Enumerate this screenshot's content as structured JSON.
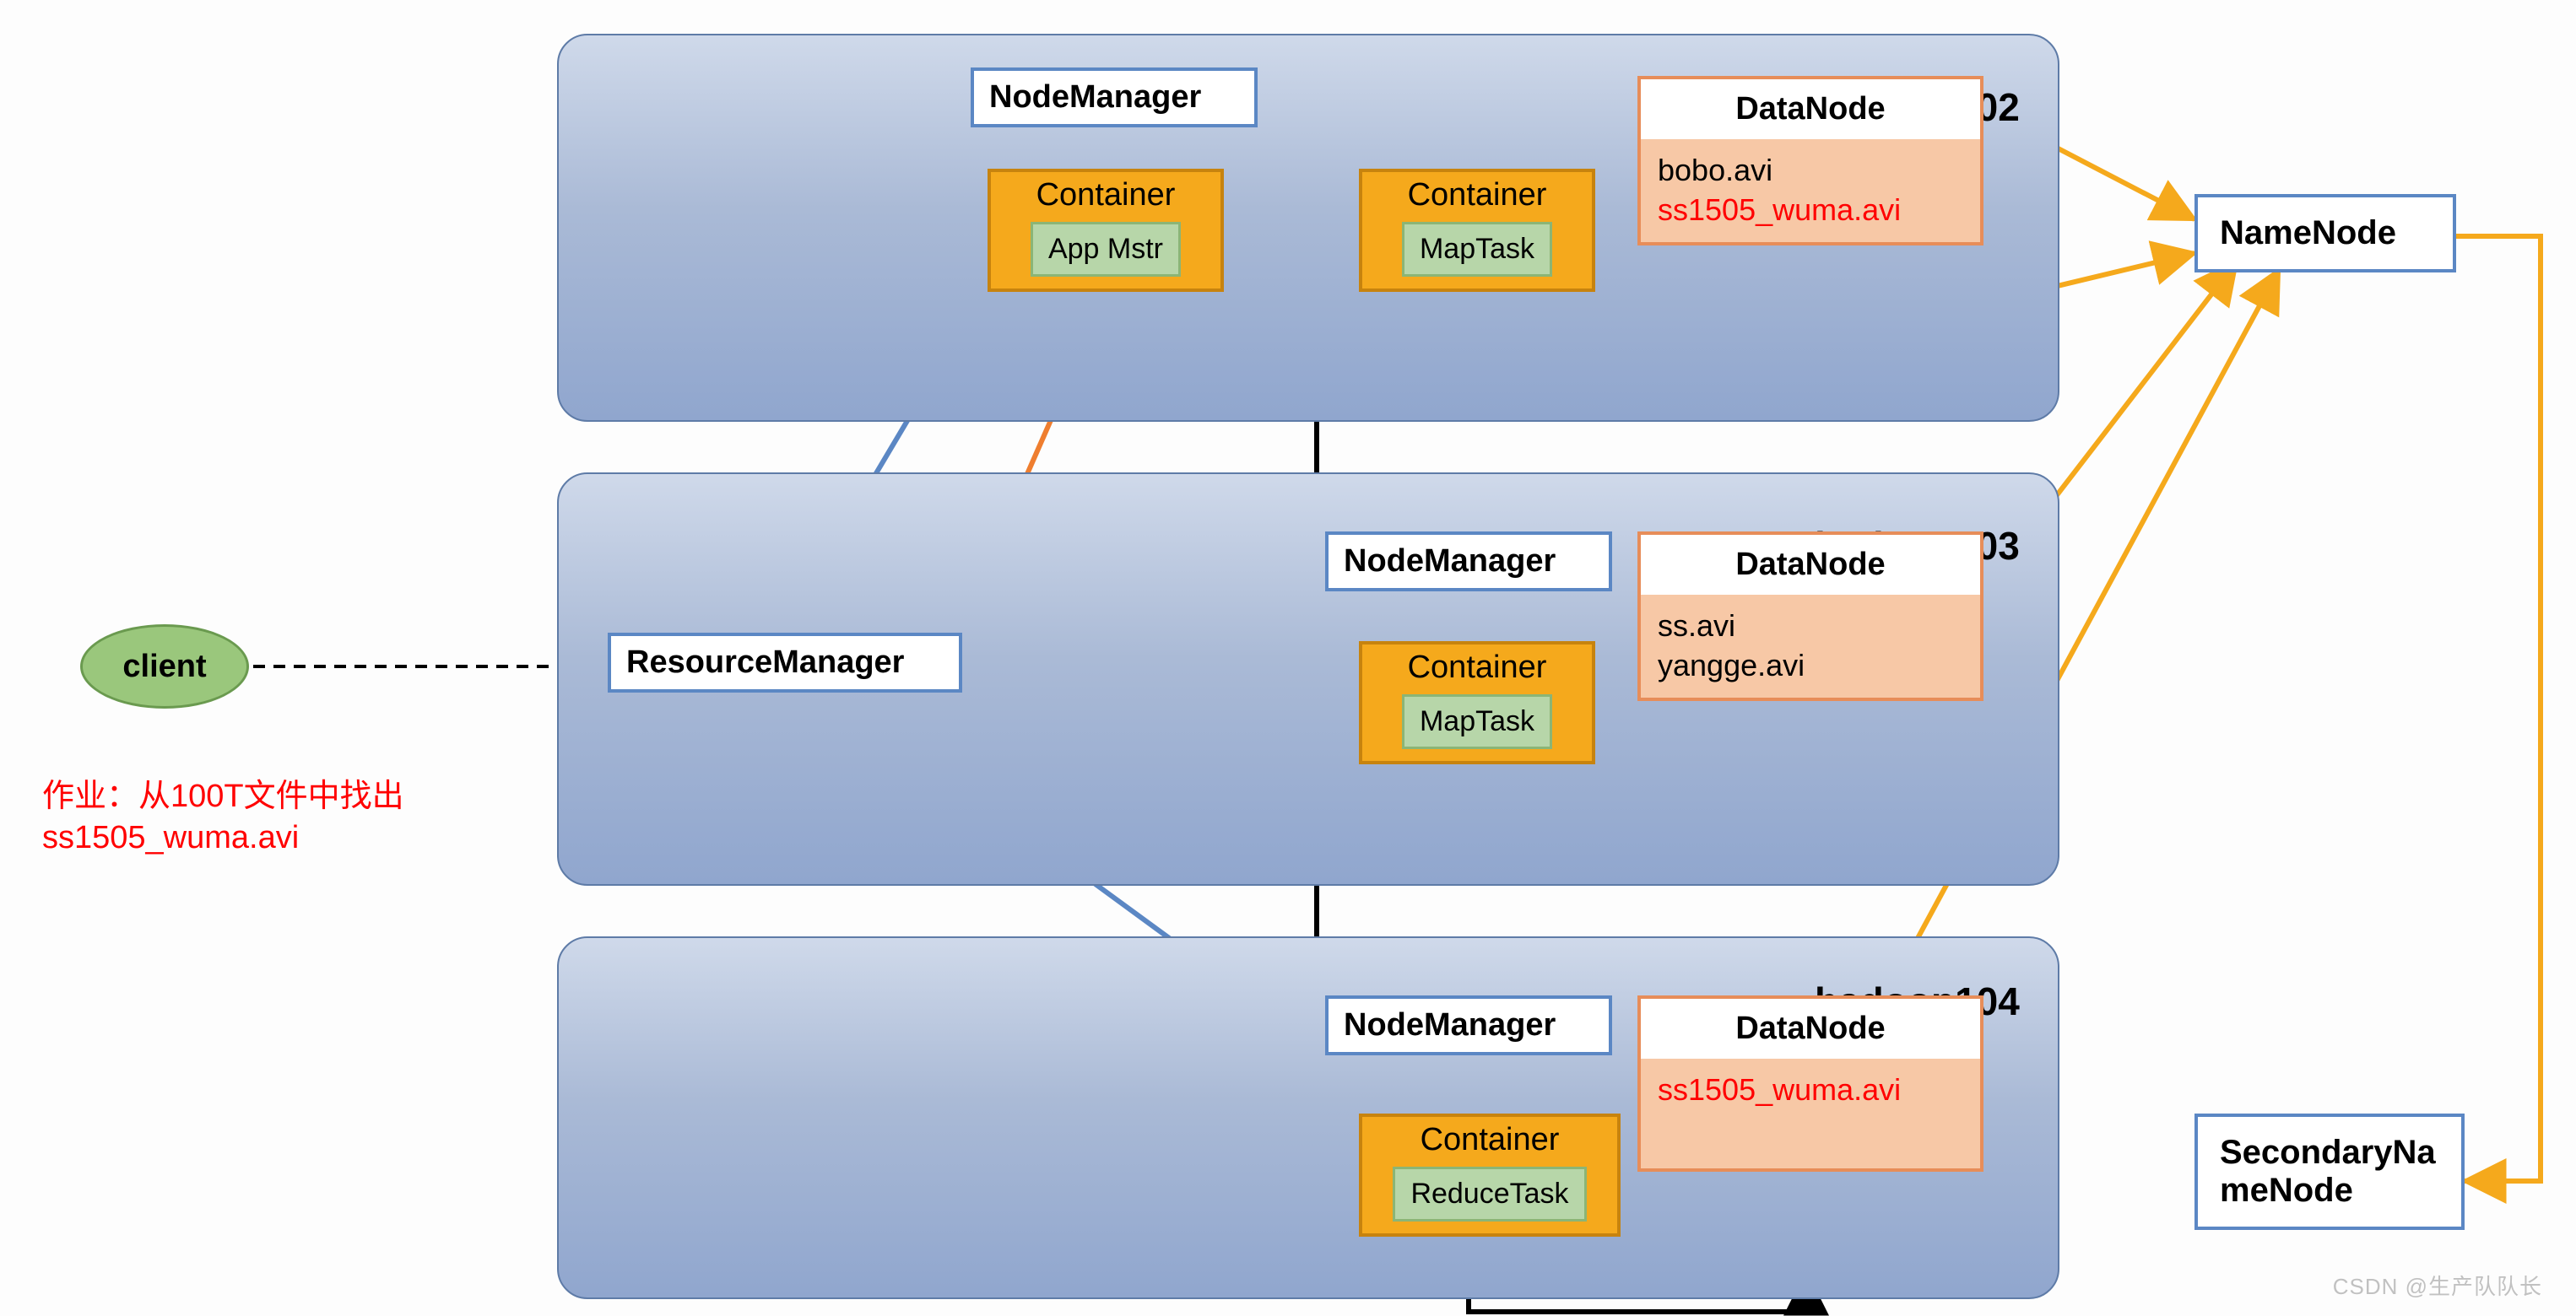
{
  "client": {
    "label": "client"
  },
  "job": {
    "line1": "作业：从100T文件中找出",
    "line2": "ss1505_wuma.avi"
  },
  "resourceManager": {
    "label": "ResourceManager"
  },
  "nameNode": {
    "label": "NameNode"
  },
  "secondaryNameNode": {
    "line1": "SecondaryNa",
    "line2": "meNode"
  },
  "hosts": {
    "h102": {
      "name": "hadoop102",
      "nodeManager": "NodeManager",
      "container1": {
        "title": "Container",
        "task": "App Mstr"
      },
      "container2": {
        "title": "Container",
        "task": "MapTask"
      },
      "dataNode": {
        "title": "DataNode",
        "files": [
          {
            "name": "bobo.avi",
            "highlight": false
          },
          {
            "name": "ss1505_wuma.avi",
            "highlight": true
          }
        ]
      }
    },
    "h103": {
      "name": "hadoop103",
      "nodeManager": "NodeManager",
      "container": {
        "title": "Container",
        "task": "MapTask"
      },
      "dataNode": {
        "title": "DataNode",
        "files": [
          {
            "name": "ss.avi",
            "highlight": false
          },
          {
            "name": "yangge.avi",
            "highlight": false
          }
        ]
      }
    },
    "h104": {
      "name": "hadoop104",
      "nodeManager": "NodeManager",
      "container": {
        "title": "Container",
        "task": "ReduceTask"
      },
      "dataNode": {
        "title": "DataNode",
        "files": [
          {
            "name": "ss1505_wuma.avi",
            "highlight": true
          }
        ]
      }
    }
  },
  "watermark": "CSDN @生产队队长"
}
